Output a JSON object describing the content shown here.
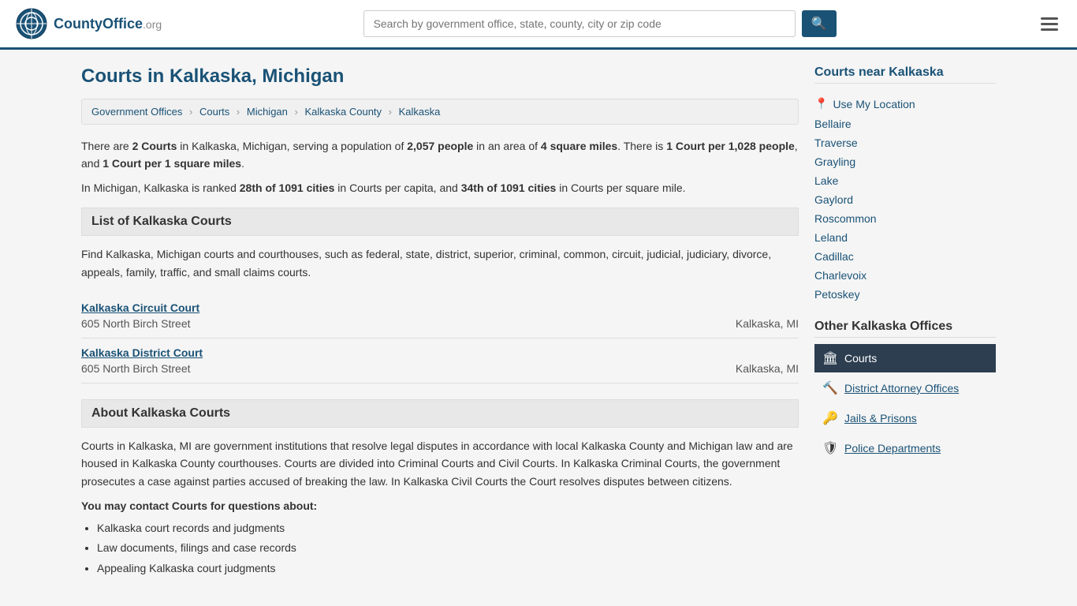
{
  "header": {
    "logo_text": "CountyOffice",
    "logo_suffix": ".org",
    "search_placeholder": "Search by government office, state, county, city or zip code",
    "search_icon": "🔍"
  },
  "page": {
    "title": "Courts in Kalkaska, Michigan",
    "breadcrumb": [
      {
        "label": "Government Offices",
        "href": "#"
      },
      {
        "label": "Courts",
        "href": "#"
      },
      {
        "label": "Michigan",
        "href": "#"
      },
      {
        "label": "Kalkaska County",
        "href": "#"
      },
      {
        "label": "Kalkaska",
        "href": "#"
      }
    ],
    "info_paragraph1": "There are ",
    "info_bold1": "2 Courts",
    "info_paragraph1b": " in Kalkaska, Michigan, serving a population of ",
    "info_bold2": "2,057 people",
    "info_paragraph1c": " in an area of ",
    "info_bold3": "4 square miles",
    "info_paragraph1d": ". There is ",
    "info_bold4": "1 Court per 1,028 people",
    "info_paragraph1e": ", and ",
    "info_bold5": "1 Court per 1 square miles",
    "info_paragraph1f": ".",
    "info_paragraph2a": "In Michigan, Kalkaska is ranked ",
    "info_bold6": "28th of 1091 cities",
    "info_paragraph2b": " in Courts per capita, and ",
    "info_bold7": "34th of 1091 cities",
    "info_paragraph2c": " in Courts per square mile.",
    "list_section_title": "List of Kalkaska Courts",
    "list_description": "Find Kalkaska, Michigan courts and courthouses, such as federal, state, district, superior, criminal, common, circuit, judicial, judiciary, divorce, appeals, family, traffic, and small claims courts.",
    "courts": [
      {
        "name": "Kalkaska Circuit Court",
        "address": "605 North Birch Street",
        "city_state": "Kalkaska, MI"
      },
      {
        "name": "Kalkaska District Court",
        "address": "605 North Birch Street",
        "city_state": "Kalkaska, MI"
      }
    ],
    "about_section_title": "About Kalkaska Courts",
    "about_text": "Courts in Kalkaska, MI are government institutions that resolve legal disputes in accordance with local Kalkaska County and Michigan law and are housed in Kalkaska County courthouses. Courts are divided into Criminal Courts and Civil Courts. In Kalkaska Criminal Courts, the government prosecutes a case against parties accused of breaking the law. In Kalkaska Civil Courts the Court resolves disputes between citizens.",
    "contact_heading": "You may contact Courts for questions about:",
    "contact_bullets": [
      "Kalkaska court records and judgments",
      "Law documents, filings and case records",
      "Appealing Kalkaska court judgments"
    ]
  },
  "sidebar": {
    "nearby_title": "Courts near Kalkaska",
    "use_location_label": "Use My Location",
    "nearby_cities": [
      "Bellaire",
      "Traverse",
      "Grayling",
      "Lake",
      "Gaylord",
      "Roscommon",
      "Leland",
      "Cadillac",
      "Charlevoix",
      "Petoskey"
    ],
    "other_offices_title": "Other Kalkaska Offices",
    "offices": [
      {
        "label": "Courts",
        "icon": "🏛",
        "active": true
      },
      {
        "label": "District Attorney Offices",
        "icon": "🔨",
        "active": false
      },
      {
        "label": "Jails & Prisons",
        "icon": "🔑",
        "active": false
      },
      {
        "label": "Police Departments",
        "icon": "🛡",
        "active": false
      }
    ]
  }
}
